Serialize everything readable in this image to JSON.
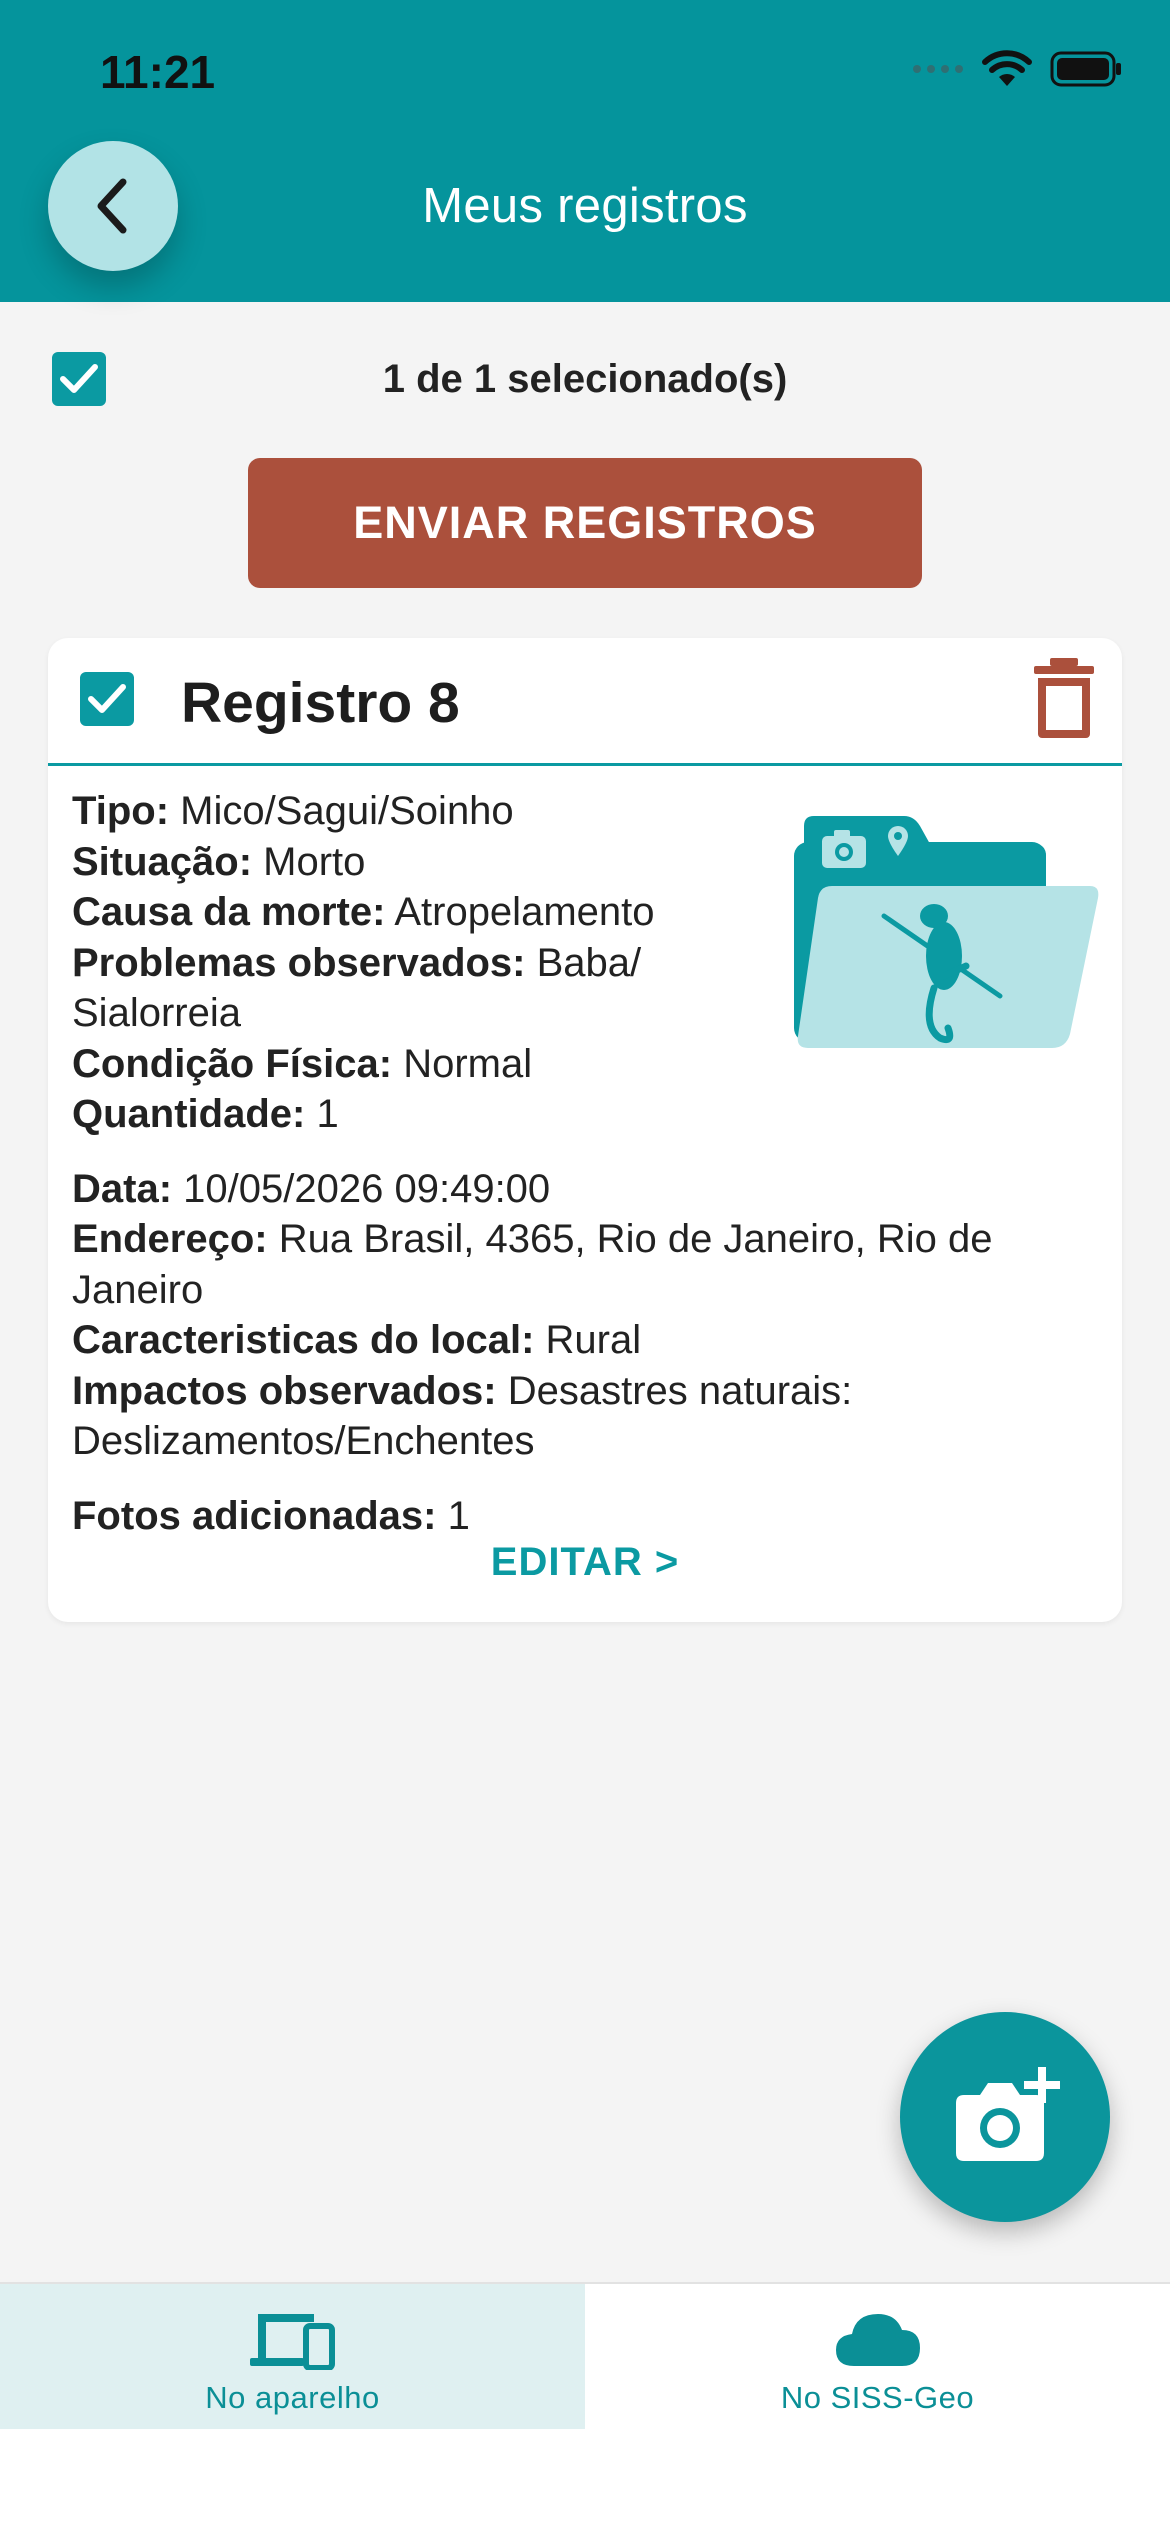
{
  "status_bar": {
    "time": "11:21"
  },
  "header": {
    "title": "Meus registros"
  },
  "selection": {
    "text": "1 de 1 selecionado(s)"
  },
  "actions": {
    "send_label": "ENVIAR REGISTROS"
  },
  "record": {
    "title": "Registro 8",
    "fields": [
      {
        "label": "Tipo:",
        "value": "Mico/Sagui/Soinho"
      },
      {
        "label": "Situação:",
        "value": "Morto"
      },
      {
        "label": "Causa da morte:",
        "value": "Atropelamento"
      },
      {
        "label": "Problemas observados:",
        "value": "Baba/ Sialorreia"
      },
      {
        "label": "Condição Física:",
        "value": "Normal"
      },
      {
        "label": "Quantidade:",
        "value": "1"
      },
      {
        "label": "Data:",
        "value": "10/05/2026 09:49:00"
      },
      {
        "label": "Endereço:",
        "value": "Rua Brasil, 4365, Rio de Janeiro, Rio de Janeiro"
      },
      {
        "label": "Caracteristicas do local:",
        "value": "Rural"
      },
      {
        "label": "Impactos observados:",
        "value": "Desastres naturais: Deslizamentos/Enchentes"
      },
      {
        "label": "Fotos adicionadas:",
        "value": "1"
      }
    ],
    "edit_label": "EDITAR >"
  },
  "tabs": [
    {
      "label": "No aparelho",
      "icon": "devices-icon",
      "active": true
    },
    {
      "label": "No SISS-Geo",
      "icon": "cloud-icon",
      "active": false
    }
  ],
  "colors": {
    "primary": "#05949c",
    "send_button": "#ab503c",
    "light_teal": "#b2e3e6"
  }
}
